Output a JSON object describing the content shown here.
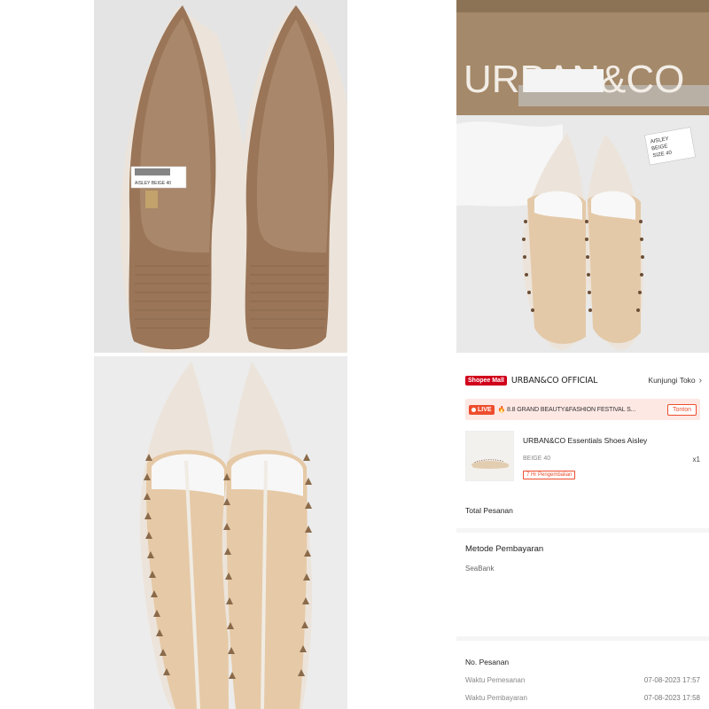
{
  "photos": {
    "soles": {
      "sticker_line": "AISLEY   BEIGE   40"
    },
    "box": {
      "brand_print": "URBAN&CO",
      "tag_lines": [
        "AISLEY",
        "BEIGE",
        "SIZE   40"
      ]
    },
    "top": {}
  },
  "order": {
    "shop": {
      "mall_badge": "Shopee Mall",
      "name": "URBAN&CO OFFICIAL",
      "visit_label": "Kunjungi Toko",
      "visit_icon": "chevron-right-icon"
    },
    "live": {
      "badge": "LIVE",
      "text": "🔥 8.8 GRAND BEAUTY&FASHION FESTIVAL S...",
      "button": "Tonton"
    },
    "product": {
      "name": "URBAN&CO Essentials Shoes Aisley",
      "variant": "BEIGE 40",
      "quantity": "x1",
      "return_badge": "7 Hr Pengembalian"
    },
    "total_label": "Total Pesanan",
    "payment": {
      "title": "Metode Pembayaran",
      "method": "SeaBank"
    },
    "order_number_label": "No. Pesanan",
    "details": [
      {
        "label": "Waktu Pemesanan",
        "value": "07-08-2023 17:57"
      },
      {
        "label": "Waktu Pembayaran",
        "value": "07-08-2023 17:58"
      }
    ]
  },
  "colors": {
    "shopee_red": "#d0011b",
    "shopee_orange": "#ee4d2d",
    "box_brown": "#a4896a",
    "shoe_beige": "#ece4da",
    "sole_brown": "#9a7558"
  }
}
